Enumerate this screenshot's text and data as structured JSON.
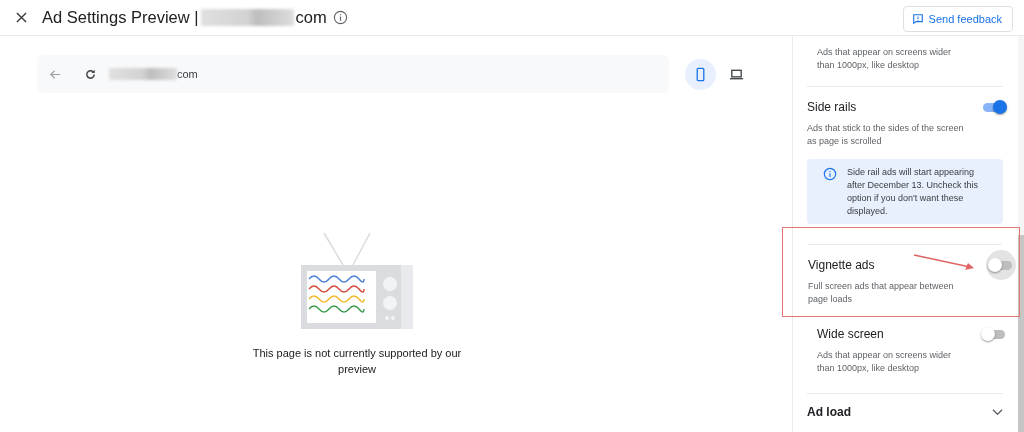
{
  "header": {
    "title": "Ad Settings Preview |",
    "title_suffix": "com",
    "feedback_button": "Send feedback"
  },
  "url_bar": {
    "url_suffix": "com"
  },
  "devices": [
    {
      "kind": "phone",
      "selected": true
    },
    {
      "kind": "laptop",
      "selected": false
    }
  ],
  "preview_message": "This page is not currently supported by our preview",
  "settings": [
    {
      "kind": "nested",
      "description": "Ads that appear on screens wider than 1000px, like desktop"
    },
    {
      "kind": "top",
      "title": "Side rails",
      "on": true,
      "description": "Ads that stick to the sides of the screen as page is scrolled",
      "note": "Side rail ads will start appearing after December 13. Uncheck this option if you don't want these displayed."
    },
    {
      "kind": "top",
      "title": "Vignette ads",
      "on": false,
      "description": "Full screen ads that appear between page loads",
      "highlighted": true
    },
    {
      "kind": "nested",
      "title": "Wide screen",
      "on": false,
      "description": "Ads that appear on screens wider than 1000px, like desktop"
    }
  ],
  "section": {
    "title": "Ad load",
    "expanded": false
  }
}
